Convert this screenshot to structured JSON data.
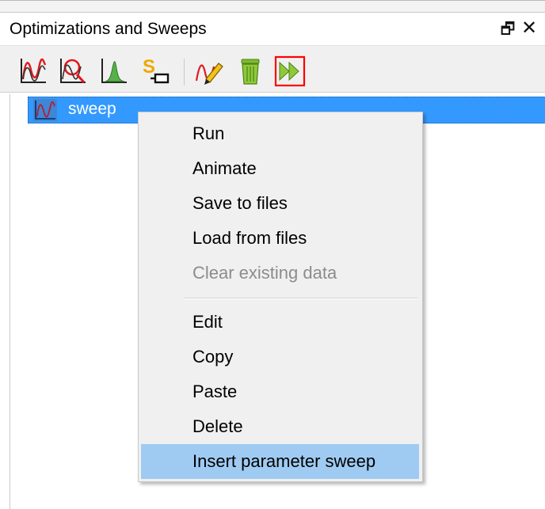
{
  "panel": {
    "title": "Optimizations and Sweeps",
    "float_glyph": "🗗",
    "close_glyph": "✕"
  },
  "toolbar": {
    "buttons": [
      {
        "name": "parameter-sweep-icon"
      },
      {
        "name": "optimization-icon"
      },
      {
        "name": "parameter-sweep-histogram-icon"
      },
      {
        "name": "script-sweep-icon"
      },
      {
        "name": "edit-pencil-icon"
      },
      {
        "name": "delete-trash-icon"
      },
      {
        "name": "run-fast-forward-icon"
      }
    ],
    "accent": "#ff0000"
  },
  "tree": {
    "item_label": "sweep",
    "selection_color": "#3399ff"
  },
  "context_menu": {
    "items": [
      {
        "label": "Run",
        "enabled": true
      },
      {
        "label": "Animate",
        "enabled": true
      },
      {
        "label": "Save to files",
        "enabled": true
      },
      {
        "label": "Load from files",
        "enabled": true
      },
      {
        "label": "Clear existing data",
        "enabled": false
      },
      {
        "label": "Edit",
        "enabled": true
      },
      {
        "label": "Copy",
        "enabled": true
      },
      {
        "label": "Paste",
        "enabled": true
      },
      {
        "label": "Delete",
        "enabled": true
      },
      {
        "label": "Insert parameter sweep",
        "enabled": true,
        "highlighted": true
      }
    ],
    "highlight_color": "#9fcbf3"
  }
}
